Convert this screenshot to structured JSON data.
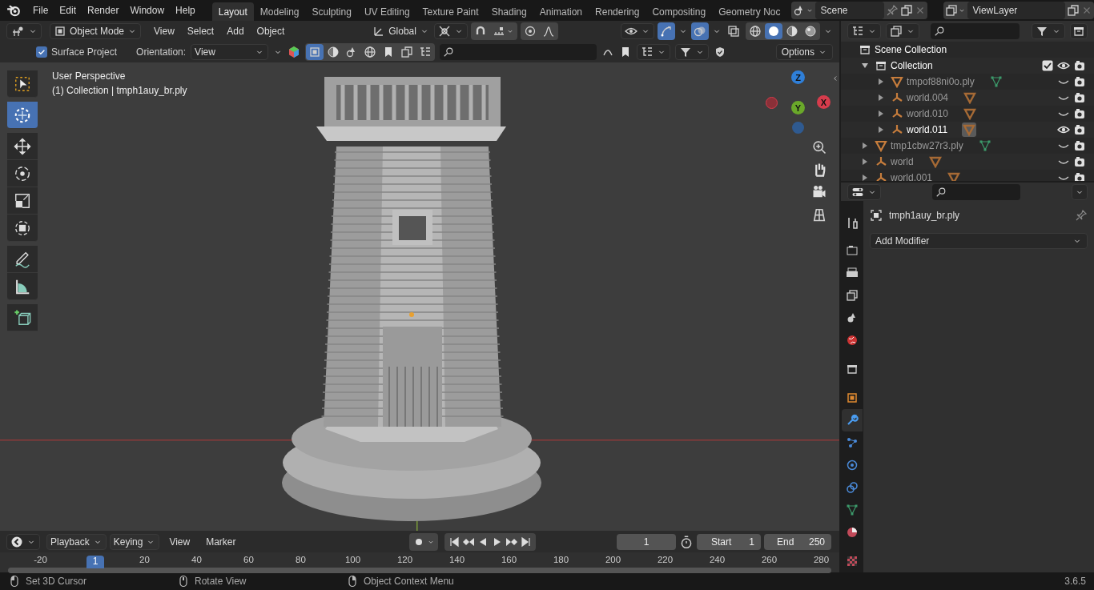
{
  "top_bar": {
    "menu": [
      "File",
      "Edit",
      "Render",
      "Window",
      "Help"
    ],
    "workspace_tabs": [
      {
        "label": "Layout",
        "selected": true
      },
      {
        "label": "Modeling",
        "selected": false
      },
      {
        "label": "Sculpting",
        "selected": false
      },
      {
        "label": "UV Editing",
        "selected": false
      },
      {
        "label": "Texture Paint",
        "selected": false
      },
      {
        "label": "Shading",
        "selected": false
      },
      {
        "label": "Animation",
        "selected": false
      },
      {
        "label": "Rendering",
        "selected": false
      },
      {
        "label": "Compositing",
        "selected": false
      },
      {
        "label": "Geometry Noc",
        "selected": false
      }
    ],
    "scene": "Scene",
    "view_layer": "ViewLayer"
  },
  "viewport": {
    "mode": "Object Mode",
    "menus": [
      "View",
      "Select",
      "Add",
      "Object"
    ],
    "orientation": "Global",
    "snap": {
      "on": false
    },
    "proportional_edit": {
      "on": false
    },
    "toggles": [
      {
        "kind": "gizmos",
        "on": true
      },
      {
        "kind": "overlays",
        "on": true
      },
      {
        "kind": "xray",
        "on": false
      }
    ],
    "shading_modes": [
      {
        "kind": "wireframe",
        "selected": false
      },
      {
        "kind": "solid",
        "selected": true
      },
      {
        "kind": "material",
        "selected": false
      },
      {
        "kind": "rendered",
        "selected": false
      }
    ],
    "tool_settings": {
      "surface_project": {
        "label": "Surface Project",
        "checked": true
      },
      "orientation_label": "Orientation:",
      "orientation_value": "View",
      "options": "Options"
    },
    "view_name": "User Perspective",
    "object_info": "(1) Collection | tmph1auy_br.ply",
    "tools": [
      {
        "kind": "select_box",
        "selected": false
      },
      {
        "kind": "cursor",
        "selected": true
      },
      {
        "kind": "move",
        "selected": false
      },
      {
        "kind": "rotate",
        "selected": false
      },
      {
        "kind": "scale",
        "selected": false
      },
      {
        "kind": "transform",
        "selected": false
      },
      {
        "kind": "annotate",
        "selected": false
      },
      {
        "kind": "measure",
        "selected": false
      },
      {
        "kind": "add_cube",
        "selected": false
      }
    ],
    "gizmo_axes": [
      "Z",
      "Y",
      "X"
    ]
  },
  "outliner": {
    "items": [
      {
        "name": "Scene Collection",
        "kind": "scene_collection",
        "children": [
          {
            "name": "Collection",
            "kind": "collection",
            "expanded": true,
            "checked": true,
            "visible": true,
            "children": [
              {
                "name": "tmpof88ni0o.ply",
                "kind": "mesh",
                "expanded": false,
                "visible": false,
                "selected": false
              },
              {
                "name": "world.004",
                "kind": "empty",
                "expanded": false,
                "visible": false,
                "selected": false
              },
              {
                "name": "world.010",
                "kind": "empty",
                "expanded": false,
                "visible": false,
                "selected": false
              },
              {
                "name": "world.011",
                "kind": "empty",
                "expanded": false,
                "visible": true,
                "selected": true
              }
            ]
          },
          {
            "name": "tmp1cbw27r3.ply",
            "kind": "mesh",
            "expanded": false,
            "visible": false,
            "selected": false
          },
          {
            "name": "world",
            "kind": "empty",
            "expanded": false,
            "visible": false,
            "selected": false
          },
          {
            "name": "world.001",
            "kind": "empty",
            "expanded": false,
            "visible": false,
            "selected": false
          }
        ]
      }
    ]
  },
  "properties": {
    "tabs": [
      {
        "kind": "tool",
        "selected": false
      },
      {
        "kind": "render",
        "selected": false
      },
      {
        "kind": "output",
        "selected": false
      },
      {
        "kind": "view_layer",
        "selected": false
      },
      {
        "kind": "scene",
        "selected": false
      },
      {
        "kind": "world",
        "selected": false
      },
      {
        "kind": "collection",
        "selected": false
      },
      {
        "kind": "object",
        "selected": false
      },
      {
        "kind": "modifiers",
        "selected": true
      },
      {
        "kind": "particles",
        "selected": false
      },
      {
        "kind": "physics",
        "selected": false
      },
      {
        "kind": "constraints",
        "selected": false
      },
      {
        "kind": "data",
        "selected": false
      },
      {
        "kind": "material",
        "selected": false
      },
      {
        "kind": "texture",
        "selected": false
      }
    ],
    "object_name": "tmph1auy_br.ply",
    "add_modifier": "Add Modifier"
  },
  "timeline": {
    "menus": [
      "Playback",
      "Keying",
      "View",
      "Marker"
    ],
    "playhead": "1",
    "ruler": [
      "-20",
      "20",
      "40",
      "60",
      "80",
      "100",
      "120",
      "140",
      "160",
      "180",
      "200",
      "220",
      "240",
      "260",
      "280"
    ],
    "current_frame": "1",
    "start_label": "Start",
    "start": "1",
    "end_label": "End",
    "end": "250"
  },
  "status_bar": {
    "hints": [
      "Set 3D Cursor",
      "Rotate View",
      "Object Context Menu"
    ],
    "version": "3.6.5"
  }
}
